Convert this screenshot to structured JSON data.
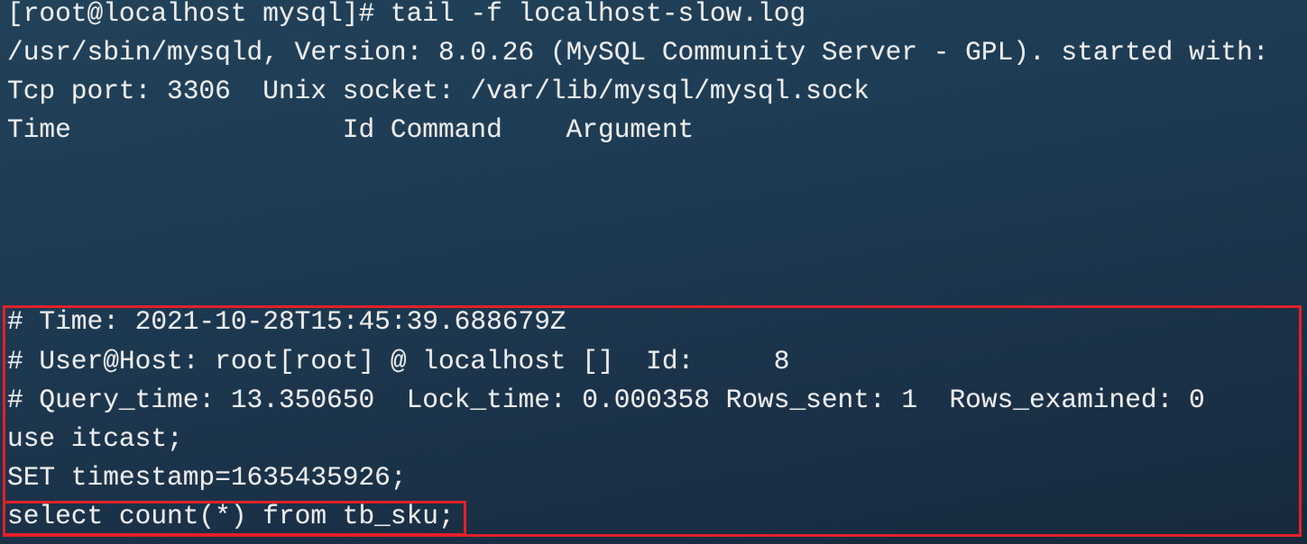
{
  "terminal": {
    "lines": [
      "[root@localhost mysql]# tail -f localhost-slow.log",
      "/usr/sbin/mysqld, Version: 8.0.26 (MySQL Community Server - GPL). started with:",
      "Tcp port: 3306  Unix socket: /var/lib/mysql/mysql.sock",
      "Time                 Id Command    Argument",
      "# Time: 2021-10-28T15:45:39.688679Z",
      "# User@Host: root[root] @ localhost []  Id:     8",
      "# Query_time: 13.350650  Lock_time: 0.000358 Rows_sent: 1  Rows_examined: 0",
      "use itcast;",
      "SET timestamp=1635435926;",
      "select count(*) from tb_sku;"
    ]
  },
  "colors": {
    "highlight_box": "#e3202a",
    "text": "#ececec"
  }
}
